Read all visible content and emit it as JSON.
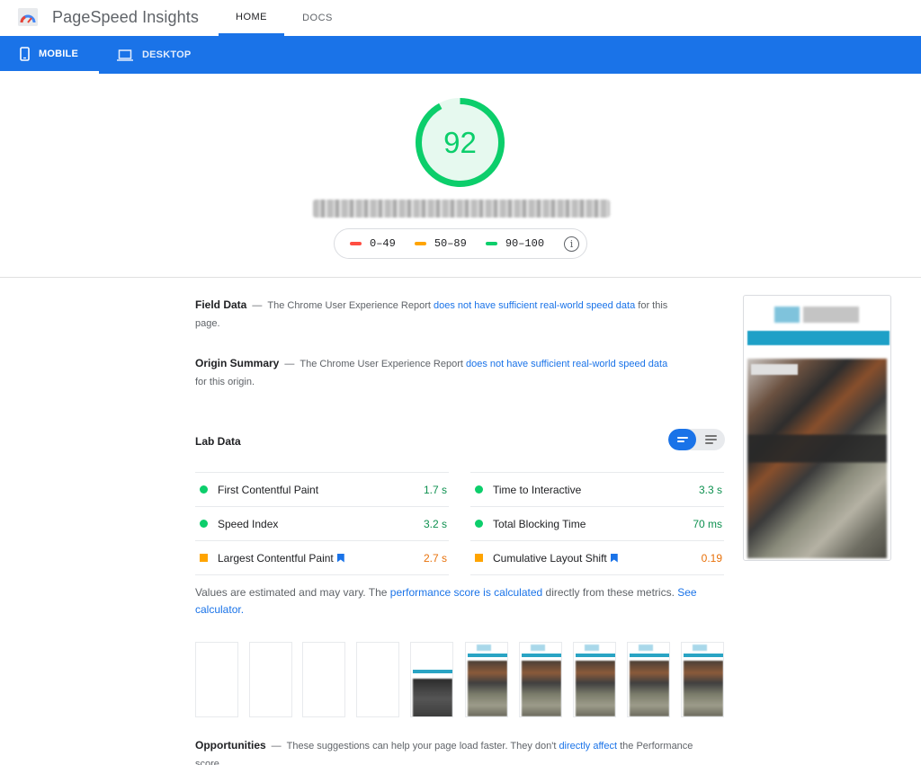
{
  "header": {
    "app_title": "PageSpeed Insights",
    "tabs": [
      {
        "label": "HOME",
        "active": true
      },
      {
        "label": "DOCS",
        "active": false
      }
    ]
  },
  "device_tabs": [
    {
      "label": "MOBILE",
      "icon": "phone-icon",
      "active": true
    },
    {
      "label": "DESKTOP",
      "icon": "laptop-icon",
      "active": false
    }
  ],
  "score": {
    "value": "92",
    "fraction": 0.92,
    "color": "#0cce6b"
  },
  "legend": {
    "items": [
      {
        "label": "0–49",
        "color": "#ff4e42"
      },
      {
        "label": "50–89",
        "color": "#ffa400"
      },
      {
        "label": "90–100",
        "color": "#0cce6b"
      }
    ],
    "info_icon": "info-icon"
  },
  "field_data": {
    "title": "Field Data",
    "dash": "—",
    "text_before": "The Chrome User Experience Report ",
    "link": "does not have sufficient real-world speed data",
    "text_after": " for this page."
  },
  "origin_summary": {
    "title": "Origin Summary",
    "dash": "—",
    "text_before": "The Chrome User Experience Report ",
    "link": "does not have sufficient real-world speed data",
    "text_after": " for this origin."
  },
  "lab_data": {
    "title": "Lab Data",
    "metrics": [
      {
        "name": "First Contentful Paint",
        "value": "1.7 s",
        "rating": "good",
        "flag": false
      },
      {
        "name": "Time to Interactive",
        "value": "3.3 s",
        "rating": "good",
        "flag": false
      },
      {
        "name": "Speed Index",
        "value": "3.2 s",
        "rating": "good",
        "flag": false
      },
      {
        "name": "Total Blocking Time",
        "value": "70 ms",
        "rating": "good",
        "flag": false
      },
      {
        "name": "Largest Contentful Paint",
        "value": "2.7 s",
        "rating": "avg",
        "flag": true
      },
      {
        "name": "Cumulative Layout Shift",
        "value": "0.19",
        "rating": "avg",
        "flag": true
      }
    ]
  },
  "estimate": {
    "text_before": "Values are estimated and may vary. The ",
    "link1": "performance score is calculated",
    "text_middle": " directly from these metrics. ",
    "link2": "See calculator."
  },
  "opportunities": {
    "title": "Opportunities",
    "dash": "—",
    "text_before": "These suggestions can help your page load faster. They don't ",
    "link": "directly affect",
    "text_after": " the Performance score."
  },
  "colors": {
    "brand_blue": "#1a73e8",
    "good": "#0cce6b",
    "average": "#ffa400",
    "poor": "#ff4e42"
  }
}
